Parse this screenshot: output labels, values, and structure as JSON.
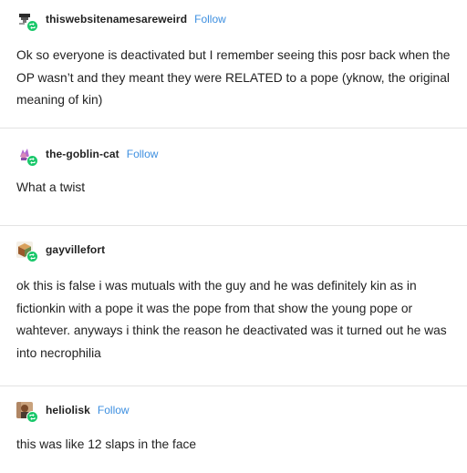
{
  "colors": {
    "accent": "#3d8fe0",
    "badge": "#1bc86b",
    "divider": "#e3e3e3"
  },
  "posts": [
    {
      "avatar_icon": "pixel-avatar-icon",
      "username": "thiswebsitenamesareweird",
      "follow_label": "Follow",
      "text": "Ok so everyone is deactivated but I remember seeing this posr back when the OP wasn’t and they meant they were RELATED to a pope (yknow, the original meaning of kin)"
    },
    {
      "avatar_icon": "goblin-avatar-icon",
      "username": "the-goblin-cat",
      "follow_label": "Follow",
      "text": "What a twist"
    },
    {
      "avatar_icon": "cube-avatar-icon",
      "username": "gayvillefort",
      "follow_label": "",
      "text": "ok this is false i was mutuals with the guy and he was definitely kin as in fictionkin with a pope it was the pope from that show the young pope or wahtever. anyways i think the reason he deactivated was it turned out he was into necrophilia"
    },
    {
      "avatar_icon": "photo-avatar-icon",
      "username": "heliolisk",
      "follow_label": "Follow",
      "text": "this was like 12 slaps in the face"
    }
  ]
}
